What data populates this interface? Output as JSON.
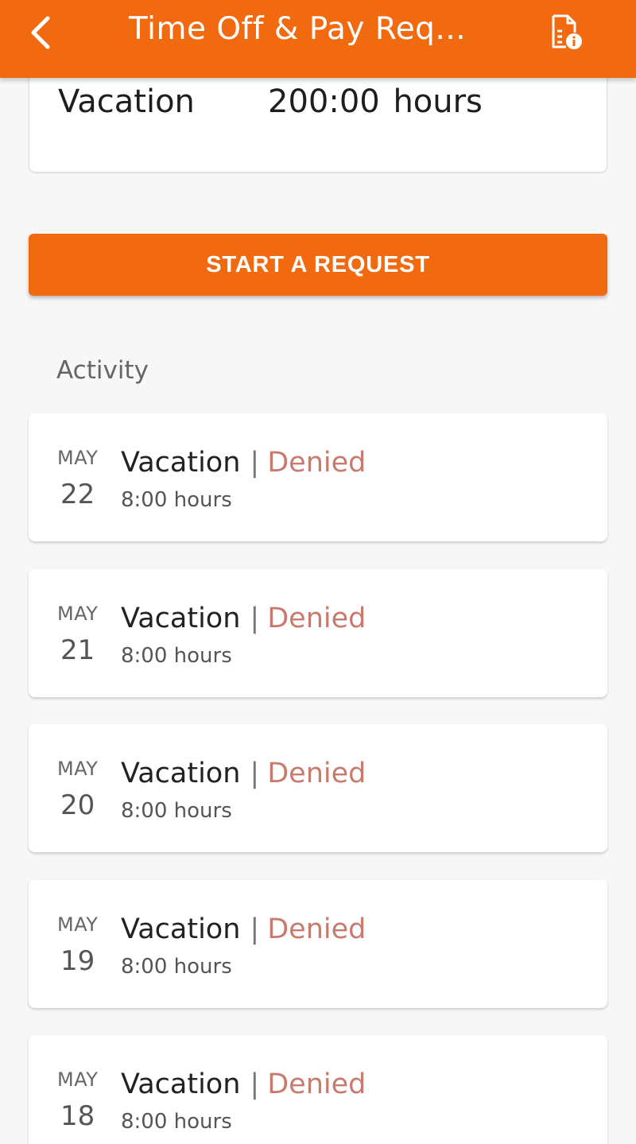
{
  "header": {
    "title": "Time Off & Pay Req...",
    "back_icon": "chevron-left-icon",
    "doc_icon": "document-info-icon",
    "color": "#f26a10"
  },
  "balance": {
    "type": "Vacation",
    "value": "200:00 hours"
  },
  "start_request": {
    "label": "START A REQUEST"
  },
  "activity": {
    "heading": "Activity",
    "items": [
      {
        "month": "MAY",
        "day": "22",
        "type": "Vacation",
        "separator": "|",
        "status": "Denied",
        "hours": "8:00 hours"
      },
      {
        "month": "MAY",
        "day": "21",
        "type": "Vacation",
        "separator": "|",
        "status": "Denied",
        "hours": "8:00 hours"
      },
      {
        "month": "MAY",
        "day": "20",
        "type": "Vacation",
        "separator": "|",
        "status": "Denied",
        "hours": "8:00 hours"
      },
      {
        "month": "MAY",
        "day": "19",
        "type": "Vacation",
        "separator": "|",
        "status": "Denied",
        "hours": "8:00 hours"
      },
      {
        "month": "MAY",
        "day": "18",
        "type": "Vacation",
        "separator": "|",
        "status": "Denied",
        "hours": "8:00 hours"
      }
    ]
  },
  "colors": {
    "accent": "#f26a10",
    "denied": "#c97a6e"
  }
}
